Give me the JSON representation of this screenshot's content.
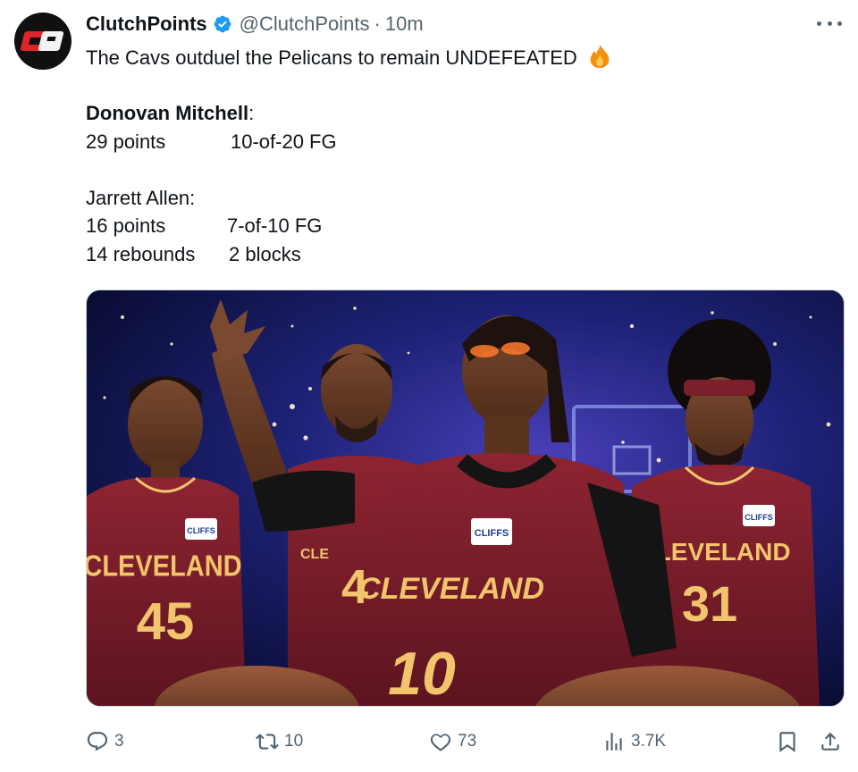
{
  "author": {
    "display_name": "ClutchPoints",
    "handle": "@ClutchPoints",
    "separator": "·",
    "time": "10m",
    "avatar_text": "CP",
    "verified": true
  },
  "tweet": {
    "headline": "The Cavs outduel the Pelicans to remain UNDEFEATED",
    "headline_emoji": "fire-emoji",
    "player1": {
      "name": "Donovan Mitchell",
      "name_suffix": ":",
      "stat1": "29 points",
      "stat2": "10-of-20 FG"
    },
    "player2": {
      "name": "Jarrett Allen:",
      "stat1": "16 points",
      "stat2": "7-of-10 FG",
      "stat3": "14 rebounds",
      "stat4": "2 blocks"
    }
  },
  "media": {
    "jerseys": [
      {
        "team": "CLEVELAND",
        "number": "45",
        "sponsor": "CLIFFS"
      },
      {
        "team": "CLE",
        "number": "4",
        "sponsor": ""
      },
      {
        "team": "CLEVELAND",
        "number": "10",
        "sponsor": "CLIFFS"
      },
      {
        "team": "CLEVELAND",
        "number": "31",
        "sponsor": "CLIFFS"
      }
    ]
  },
  "actions": {
    "replies": "3",
    "reposts": "10",
    "likes": "73",
    "views": "3.7K"
  },
  "colors": {
    "brand_red": "#e0232b",
    "verified_blue": "#1d9bf0",
    "muted_text": "#536471",
    "wine": "#7a1f2b",
    "gold": "#f2c46b"
  }
}
